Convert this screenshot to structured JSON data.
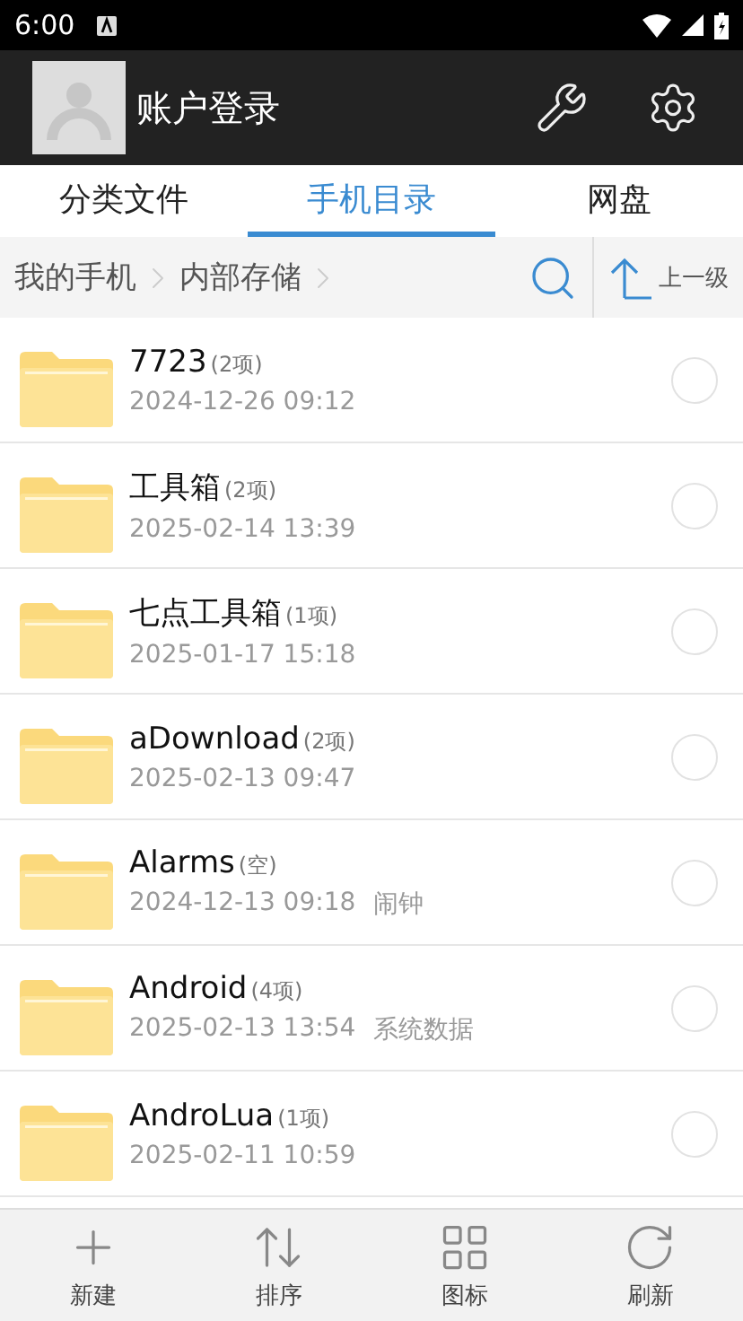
{
  "status_bar": {
    "time": "6:00"
  },
  "header": {
    "title": "账户登录"
  },
  "tabs": [
    {
      "label": "分类文件",
      "selected": false
    },
    {
      "label": "手机目录",
      "selected": true
    },
    {
      "label": "网盘",
      "selected": false
    }
  ],
  "breadcrumbs": [
    "我的手机",
    "内部存储"
  ],
  "up_button": {
    "label": "上一级"
  },
  "files": [
    {
      "name": "7723",
      "count": "(2项)",
      "time": "2024-12-26 09:12",
      "selected": false
    },
    {
      "name": "工具箱",
      "count": "(2项)",
      "time": "2025-02-14 13:39",
      "selected": false
    },
    {
      "name": "七点工具箱",
      "count": "(1项)",
      "time": "2025-01-17 15:18",
      "selected": false
    },
    {
      "name": "aDownload",
      "count": "(2项)",
      "time": "2025-02-13 09:47",
      "selected": false
    },
    {
      "name": "Alarms",
      "count": "(空)",
      "time": "2024-12-13 09:18",
      "note": "闹钟",
      "selected": false
    },
    {
      "name": "Android",
      "count": "(4项)",
      "time": "2025-02-13 13:54",
      "note": "系统数据",
      "selected": false
    },
    {
      "name": "AndroLua",
      "count": "(1项)",
      "time": "2025-02-11 10:59",
      "selected": false
    }
  ],
  "toolbar": [
    {
      "kind": "new",
      "label": "新建"
    },
    {
      "kind": "sort",
      "label": "排序"
    },
    {
      "kind": "grid",
      "label": "图标"
    },
    {
      "kind": "refresh",
      "label": "刷新"
    }
  ]
}
